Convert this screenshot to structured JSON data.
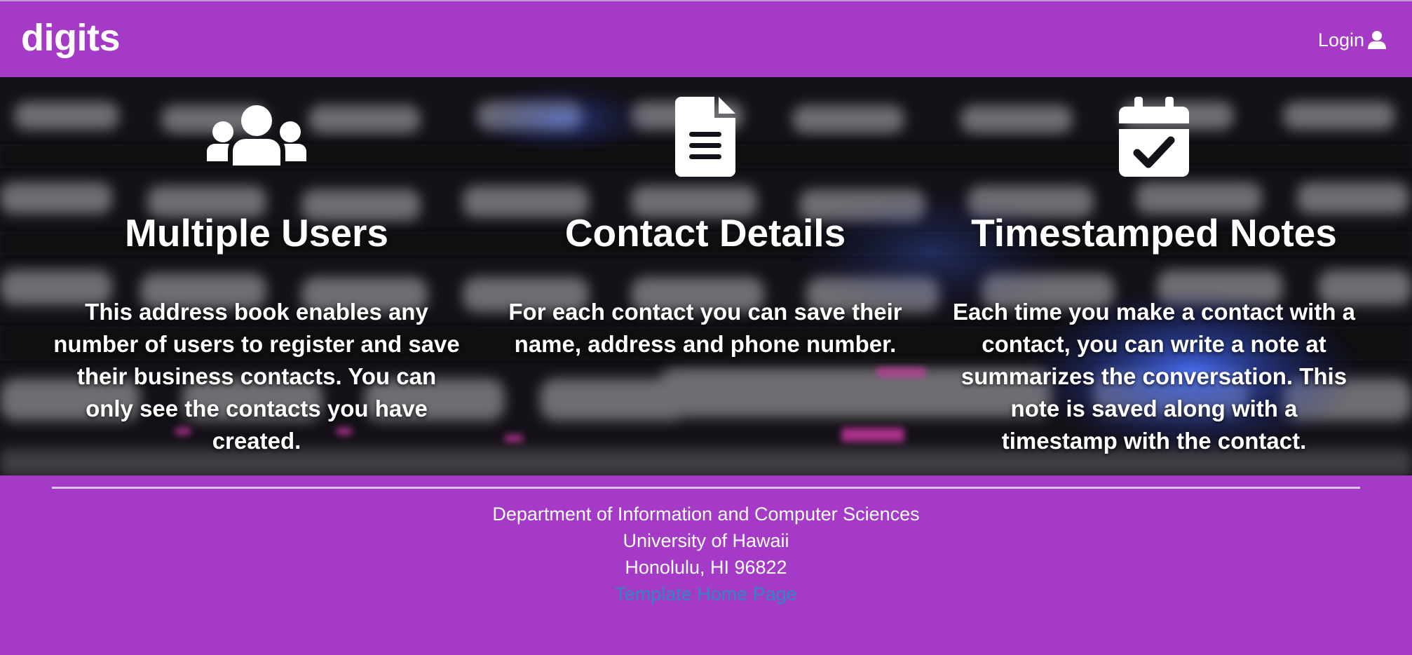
{
  "navbar": {
    "brand": "digits",
    "login_label": "Login",
    "login_icon": "user-icon"
  },
  "features": [
    {
      "icon": "users-icon",
      "title": "Multiple Users",
      "description": "This address book enables any number of users to register and save their business contacts. You can only see the contacts you have created."
    },
    {
      "icon": "file-icon",
      "title": "Contact Details",
      "description": "For each contact you can save their name, address and phone number."
    },
    {
      "icon": "calendar-check-icon",
      "title": "Timestamped Notes",
      "description": "Each time you make a contact with a contact, you can write a note at summarizes the conversation. This note is saved along with a timestamp with the contact."
    }
  ],
  "footer": {
    "line1": "Department of Information and Computer Sciences",
    "line2": "University of Hawaii",
    "line3": "Honolulu, HI 96822",
    "link_text": "Template Home Page"
  },
  "colors": {
    "brand_purple": "#a43ac6",
    "link_blue": "#2f86c6",
    "text_white": "#ffffff"
  }
}
